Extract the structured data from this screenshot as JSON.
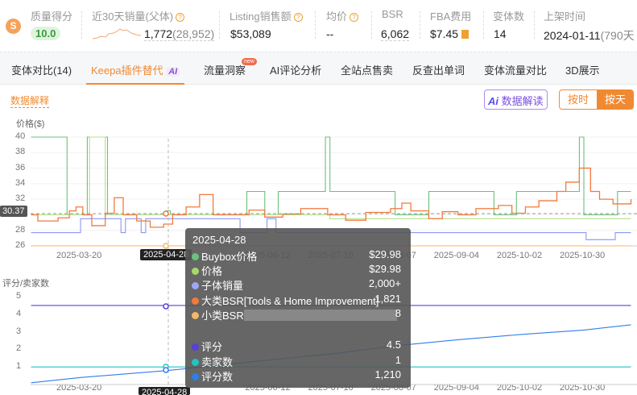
{
  "header": {
    "quality": {
      "label": "质量得分",
      "value": "10.0"
    },
    "sales30": {
      "label": "近30天销量(父体)",
      "value": "1,772",
      "parent": "(28,952)"
    },
    "listing_sales": {
      "label": "Listing销售额",
      "value": "$53,089"
    },
    "avg_price": {
      "label": "均价",
      "value": "--"
    },
    "bsr": {
      "label": "BSR",
      "value": "6,062"
    },
    "fba": {
      "label": "FBA费用",
      "value": "$7.45"
    },
    "variants": {
      "label": "变体数",
      "value": "14"
    },
    "listed": {
      "label": "上架时间",
      "value": "2024-01-11",
      "days": "(790天"
    }
  },
  "tabs": [
    {
      "label": "变体对比(14)"
    },
    {
      "label": "Keepa插件替代",
      "badge": "AI",
      "active": true
    },
    {
      "label": "流量洞察",
      "badge": "new"
    },
    {
      "label": "AI评论分析"
    },
    {
      "label": "全站点售卖"
    },
    {
      "label": "反查出单词"
    },
    {
      "label": "变体流量对比"
    },
    {
      "label": "3D展示"
    }
  ],
  "toolbar": {
    "explain": "数据解释",
    "ai_button": "数据解读",
    "ai_logo": "Ai",
    "by_hour": "按时",
    "by_day": "按天"
  },
  "colors": {
    "accent": "#f08a32",
    "buybox": "#6cc17a",
    "price": "#a6d96a",
    "child_sales": "#7f8cf0",
    "main_bsr": "#f27a3c",
    "sub_bsr": "#f5b86a",
    "rating": "#5b3fd8",
    "sellers": "#22c3c3",
    "reviews": "#2f7fe8"
  },
  "chart_data": [
    {
      "type": "line",
      "ylabel": "价格($)",
      "ylim": [
        26,
        40
      ],
      "yticks": [
        "40",
        "38",
        "36",
        "34",
        "32",
        "30",
        "28",
        "26"
      ],
      "xticks": [
        "2025-03-20",
        "2025-04-28",
        "2025-06-12",
        "2025-07-10",
        "2025-08-07",
        "2025-09-04",
        "2025-10-02",
        "2025-10-30"
      ],
      "crosshair": {
        "date": "2025-04-28",
        "value_label": "30.37"
      },
      "series": [
        {
          "name": "Buybox价格",
          "color": "#6cc17a",
          "points": [
            [
              "2025-02-26",
              40
            ],
            [
              "2025-03-14",
              30
            ],
            [
              "2025-03-23",
              40
            ],
            [
              "2025-04-01",
              30
            ],
            [
              "2025-04-27",
              30.5
            ],
            [
              "2025-04-29",
              30
            ],
            [
              "2025-06-02",
              33
            ],
            [
              "2025-06-10",
              30
            ],
            [
              "2025-06-16",
              33
            ],
            [
              "2025-07-07",
              40
            ],
            [
              "2025-07-09",
              33
            ],
            [
              "2025-08-07",
              30
            ],
            [
              "2025-08-22",
              33
            ],
            [
              "2025-09-20",
              30
            ],
            [
              "2025-09-30",
              33
            ],
            [
              "2025-10-28",
              40
            ],
            [
              "2025-10-30",
              30
            ],
            [
              "2025-11-14",
              33
            ],
            [
              "2025-11-20",
              33
            ]
          ]
        },
        {
          "name": "价格",
          "color": "#b5e08a",
          "points": [
            [
              "2025-02-26",
              30
            ],
            [
              "2025-03-24",
              40
            ],
            [
              "2025-03-31",
              30
            ],
            [
              "2025-07-09",
              29.5
            ],
            [
              "2025-11-20",
              29.5
            ]
          ]
        },
        {
          "name": "子体销量",
          "color": "#8b96f2",
          "points": [
            [
              "2025-02-26",
              27.7
            ],
            [
              "2025-03-20",
              29.5
            ],
            [
              "2025-04-07",
              27.7
            ],
            [
              "2025-04-09",
              29.5
            ],
            [
              "2025-04-16",
              27.7
            ],
            [
              "2025-04-18",
              29.5
            ],
            [
              "2025-05-30",
              27.7
            ],
            [
              "2025-06-11",
              29.5
            ],
            [
              "2025-06-15",
              27.7
            ],
            [
              "2025-10-31",
              26.8
            ],
            [
              "2025-11-13",
              27.7
            ],
            [
              "2025-11-20",
              27.7
            ]
          ]
        },
        {
          "name": "大类BSR",
          "color": "#f27a3c",
          "points": [
            [
              "2025-02-26",
              30
            ],
            [
              "2025-03-01",
              29.2
            ],
            [
              "2025-03-10",
              29.6
            ],
            [
              "2025-03-15",
              30.5
            ],
            [
              "2025-03-18",
              31
            ],
            [
              "2025-03-21",
              30
            ],
            [
              "2025-03-25",
              28.6
            ],
            [
              "2025-03-31",
              30.2
            ],
            [
              "2025-04-04",
              32.2
            ],
            [
              "2025-04-08",
              30
            ],
            [
              "2025-04-14",
              29.2
            ],
            [
              "2025-04-20",
              28.4
            ],
            [
              "2025-04-26",
              28.8
            ],
            [
              "2025-04-30",
              30
            ],
            [
              "2025-05-06",
              31
            ],
            [
              "2025-05-12",
              32.6
            ],
            [
              "2025-05-18",
              30
            ],
            [
              "2025-05-28",
              30
            ],
            [
              "2025-06-03",
              30.6
            ],
            [
              "2025-06-10",
              29.7
            ],
            [
              "2025-06-18",
              30.1
            ],
            [
              "2025-06-26",
              30.8
            ],
            [
              "2025-07-08",
              30
            ],
            [
              "2025-07-16",
              29.3
            ],
            [
              "2025-07-25",
              30.3
            ],
            [
              "2025-08-05",
              30.8
            ],
            [
              "2025-08-10",
              31.5
            ],
            [
              "2025-08-14",
              30.5
            ],
            [
              "2025-08-22",
              29.5
            ],
            [
              "2025-08-28",
              30.4
            ],
            [
              "2025-09-04",
              30
            ],
            [
              "2025-09-12",
              30.8
            ],
            [
              "2025-09-22",
              31.2
            ],
            [
              "2025-09-28",
              30.2
            ],
            [
              "2025-10-04",
              31
            ],
            [
              "2025-10-10",
              31.8
            ],
            [
              "2025-10-18",
              33
            ],
            [
              "2025-10-22",
              34.2
            ],
            [
              "2025-10-28",
              36
            ],
            [
              "2025-11-02",
              33
            ],
            [
              "2025-11-06",
              32
            ],
            [
              "2025-11-12",
              31.4
            ],
            [
              "2025-11-20",
              32
            ]
          ]
        },
        {
          "name": "小类BSR",
          "color": "#f5b86a",
          "points": [
            [
              "2025-02-26",
              26
            ],
            [
              "2025-11-20",
              26
            ]
          ]
        }
      ]
    },
    {
      "type": "line",
      "ylabel": "评分/卖家数",
      "ylim": [
        0,
        5
      ],
      "yticks": [
        "5",
        "4",
        "3",
        "2",
        "1"
      ],
      "series": [
        {
          "name": "评分",
          "color": "#5b3fd8",
          "points": [
            [
              "2025-02-26",
              4.5
            ],
            [
              "2025-11-20",
              4.5
            ]
          ]
        },
        {
          "name": "卖家数",
          "color": "#22c3c3",
          "points": [
            [
              "2025-02-26",
              1
            ],
            [
              "2025-11-20",
              1
            ]
          ]
        },
        {
          "name": "评分数",
          "color": "#2f7fe8",
          "points": [
            [
              "2025-02-26",
              0.1
            ],
            [
              "2025-03-20",
              0.4
            ],
            [
              "2025-04-28",
              0.8
            ],
            [
              "2025-06-12",
              1.4
            ],
            [
              "2025-07-10",
              1.75
            ],
            [
              "2025-08-07",
              2.2
            ],
            [
              "2025-09-04",
              2.55
            ],
            [
              "2025-10-02",
              2.85
            ],
            [
              "2025-10-30",
              3.1
            ],
            [
              "2025-11-20",
              3.4
            ]
          ]
        }
      ]
    }
  ],
  "tooltip": {
    "date": "2025-04-28",
    "rows": [
      {
        "label": "Buybox价格",
        "value": "$29.98",
        "color": "#6cc17a"
      },
      {
        "label": "价格",
        "value": "$29.98",
        "color": "#a6d96a"
      },
      {
        "label": "子体销量",
        "value": "2,000+",
        "color": "#9ea6f5"
      },
      {
        "label": "大类BSR[Tools & Home Improvement]",
        "value": "1,821",
        "color": "#f27a3c"
      },
      {
        "label": "小类BSR",
        "value": "8",
        "color": "#f5b86a"
      },
      {
        "label": "评分",
        "value": "4.5",
        "color": "#5b3fd8"
      },
      {
        "label": "卖家数",
        "value": "1",
        "color": "#22c3c3"
      },
      {
        "label": "评分数",
        "value": "1,210",
        "color": "#2f7fe8"
      }
    ]
  }
}
